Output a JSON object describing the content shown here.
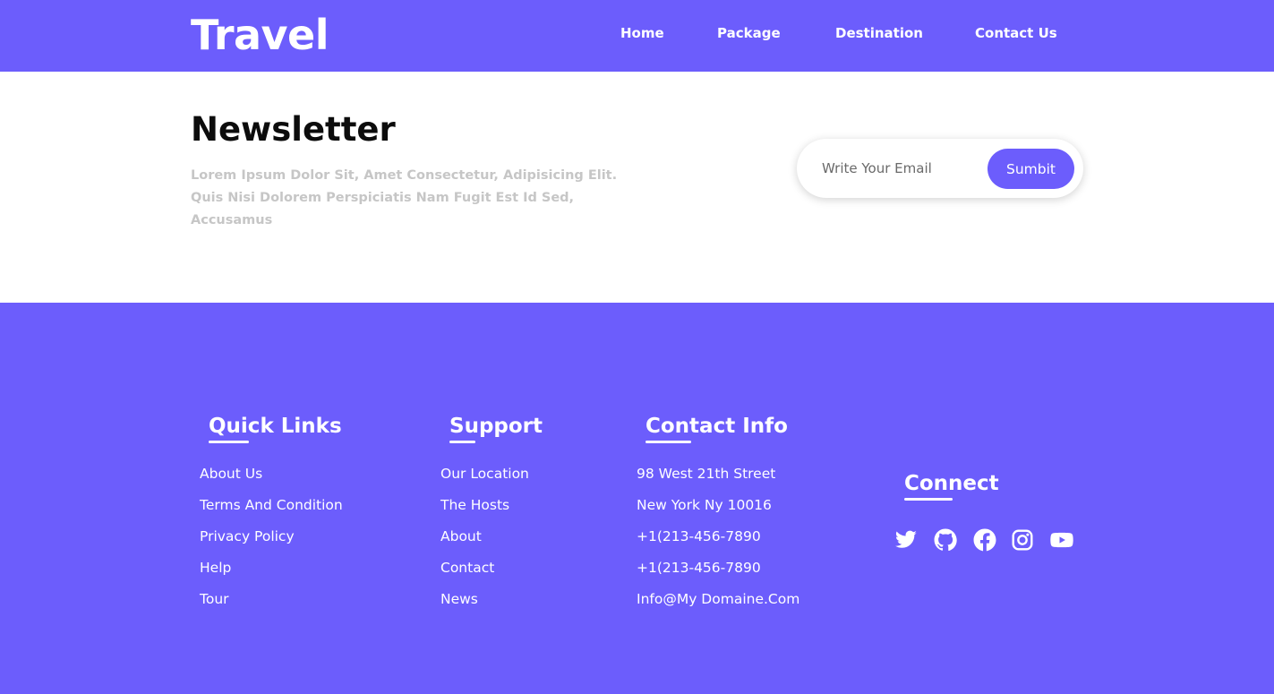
{
  "header": {
    "logo": "Travel",
    "nav": [
      "Home",
      "Package",
      "Destination",
      "Contact Us"
    ]
  },
  "newsletter": {
    "title": "Newsletter",
    "description": "Lorem Ipsum Dolor Sit, Amet Consectetur, Adipisicing Elit. Quis Nisi Dolorem Perspiciatis Nam Fugit Est Id Sed, Accusamus",
    "email_placeholder": "Write Your Email",
    "email_value": "",
    "submit_label": "Sumbit"
  },
  "footer": {
    "quick_links": {
      "title": "Quick Links",
      "items": [
        "About Us",
        "Terms And Condition",
        "Privacy Policy",
        "Help",
        "Tour"
      ]
    },
    "support": {
      "title": "Support",
      "items": [
        "Our Location",
        "The Hosts",
        "About",
        "Contact",
        "News"
      ]
    },
    "contact_info": {
      "title": "Contact Info",
      "items": [
        "98 West 21th Street",
        "New York Ny 10016",
        "+1(213-456-7890",
        "+1(213-456-7890",
        "Info@My Domaine.Com"
      ]
    },
    "connect": {
      "title": "Connect",
      "icons": [
        "twitter-icon",
        "github-icon",
        "facebook-icon",
        "instagram-icon",
        "youtube-icon"
      ]
    }
  },
  "colors": {
    "brand": "#6c5dfc",
    "text_dark": "#0c0c0c",
    "muted_text": "#c6c6c6",
    "white": "#ffffff"
  }
}
